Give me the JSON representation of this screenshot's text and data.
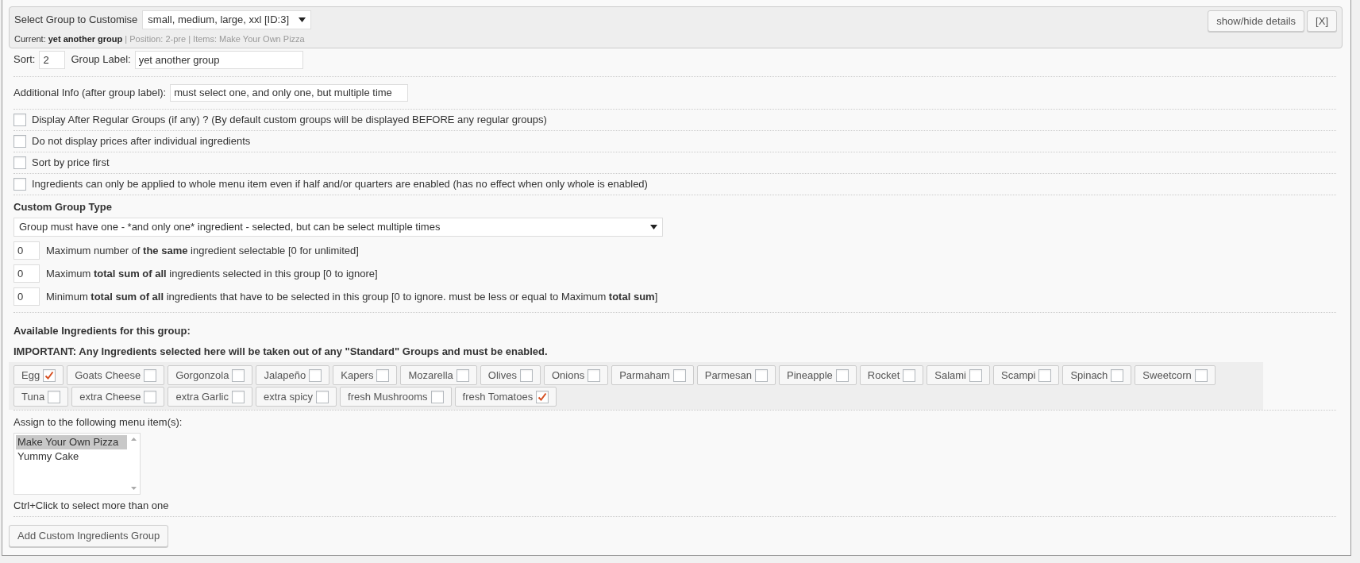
{
  "header": {
    "select_label": "Select Group to Customise",
    "group_select": "small, medium, large, xxl [ID:3]",
    "current_label": "Current:",
    "current_value": "yet another group",
    "position": "| Position: 2-pre | Items: Make Your Own Pizza",
    "buttons": [
      "show/hide details",
      "[X]"
    ]
  },
  "sort": {
    "label": "Sort:",
    "value": "2"
  },
  "group_label": {
    "label": "Group Label:",
    "value": "yet another group"
  },
  "additional_info": {
    "label": "Additional Info (after group label):",
    "value": "must select one, and only one, but multiple time"
  },
  "options": [
    {
      "label": "Display After Regular Groups (if any) ? (By default custom groups will be displayed BEFORE any regular groups)",
      "checked": false
    },
    {
      "label": "Do not display prices after individual ingredients",
      "checked": false
    },
    {
      "label": "Sort by price first",
      "checked": false
    },
    {
      "label": "Ingredients can only be applied to whole menu item even if half and/or quarters are enabled (has no effect when only whole is enabled)",
      "checked": false
    }
  ],
  "custom_group_type": {
    "label": "Custom Group Type",
    "value": "Group must have one - *and only one* ingredient - selected, but can be select multiple times"
  },
  "limits": [
    {
      "value": "0",
      "label": "Maximum number of **the same** ingredient selectable [0 for unlimited]"
    },
    {
      "value": "0",
      "label": "Maximum **total sum of all** ingredients selected in this group [0 to ignore]"
    },
    {
      "value": "0",
      "label": "Minimum **total sum of all** ingredients that have to be selected in this group [0 to ignore. must be less or equal to Maximum **total sum**]"
    }
  ],
  "available_heading": "Available Ingredients for this group:",
  "important_note": "IMPORTANT: Any Ingredients selected here will be taken out of any \"Standard\" Groups and must be enabled.",
  "ingredients": [
    {
      "label": "Egg",
      "checked": true
    },
    {
      "label": "Goats Cheese",
      "checked": false
    },
    {
      "label": "Gorgonzola",
      "checked": false
    },
    {
      "label": "Jalapeño",
      "checked": false
    },
    {
      "label": "Kapers",
      "checked": false
    },
    {
      "label": "Mozarella",
      "checked": false
    },
    {
      "label": "Olives",
      "checked": false
    },
    {
      "label": "Onions",
      "checked": false
    },
    {
      "label": "Parmaham",
      "checked": false
    },
    {
      "label": "Parmesan",
      "checked": false
    },
    {
      "label": "Pineapple",
      "checked": false
    },
    {
      "label": "Rocket",
      "checked": false
    },
    {
      "label": "Salami",
      "checked": false
    },
    {
      "label": "Scampi",
      "checked": false
    },
    {
      "label": "Spinach",
      "checked": false
    },
    {
      "label": "Sweetcorn",
      "checked": false
    },
    {
      "label": "Tuna",
      "checked": false
    },
    {
      "label": "extra Cheese",
      "checked": false
    },
    {
      "label": "extra Garlic",
      "checked": false
    },
    {
      "label": "extra spicy",
      "checked": false
    },
    {
      "label": "fresh Mushrooms",
      "checked": false
    },
    {
      "label": "fresh Tomatoes",
      "checked": true
    }
  ],
  "assign": {
    "label": "Assign to the following menu item(s):",
    "items": [
      {
        "label": "Make Your Own Pizza",
        "selected": true
      },
      {
        "label": "Yummy Cake",
        "selected": false
      }
    ],
    "hint": "Ctrl+Click to select more than one"
  },
  "add_button": "Add Custom Ingredients Group"
}
